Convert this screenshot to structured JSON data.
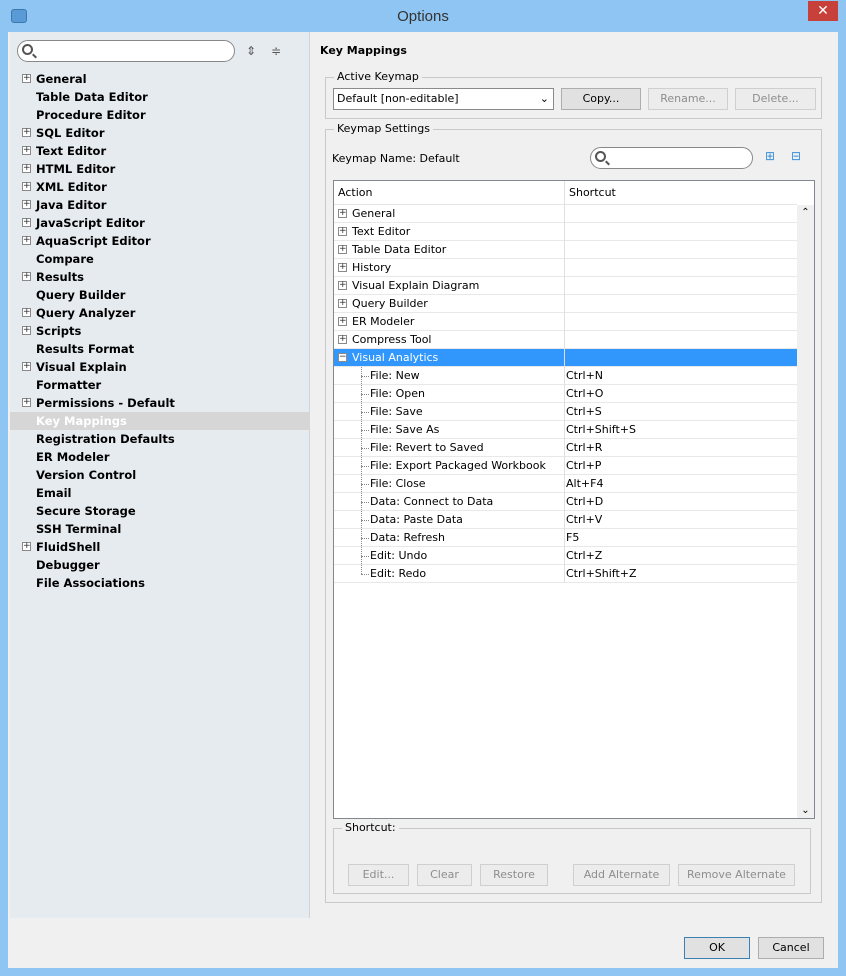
{
  "window": {
    "title": "Options",
    "close": "✕"
  },
  "nav": {
    "items": [
      {
        "label": "General",
        "expandable": true
      },
      {
        "label": "Table Data Editor",
        "expandable": false
      },
      {
        "label": "Procedure Editor",
        "expandable": false
      },
      {
        "label": "SQL Editor",
        "expandable": true
      },
      {
        "label": "Text Editor",
        "expandable": true
      },
      {
        "label": "HTML Editor",
        "expandable": true
      },
      {
        "label": "XML Editor",
        "expandable": true
      },
      {
        "label": "Java Editor",
        "expandable": true
      },
      {
        "label": "JavaScript Editor",
        "expandable": true
      },
      {
        "label": "AquaScript Editor",
        "expandable": true
      },
      {
        "label": "Compare",
        "expandable": false
      },
      {
        "label": "Results",
        "expandable": true
      },
      {
        "label": "Query Builder",
        "expandable": false
      },
      {
        "label": "Query Analyzer",
        "expandable": true
      },
      {
        "label": "Scripts",
        "expandable": true
      },
      {
        "label": "Results Format",
        "expandable": false
      },
      {
        "label": "Visual Explain",
        "expandable": true
      },
      {
        "label": "Formatter",
        "expandable": false
      },
      {
        "label": "Permissions - Default",
        "expandable": true
      },
      {
        "label": "Key Mappings",
        "expandable": false,
        "selected": true
      },
      {
        "label": "Registration Defaults",
        "expandable": false
      },
      {
        "label": "ER Modeler",
        "expandable": false
      },
      {
        "label": "Version Control",
        "expandable": false
      },
      {
        "label": "Email",
        "expandable": false
      },
      {
        "label": "Secure Storage",
        "expandable": false
      },
      {
        "label": "SSH Terminal",
        "expandable": false
      },
      {
        "label": "FluidShell",
        "expandable": true
      },
      {
        "label": "Debugger",
        "expandable": false
      },
      {
        "label": "File Associations",
        "expandable": false
      }
    ]
  },
  "main": {
    "heading": "Key Mappings",
    "active_keymap": {
      "label": "Active Keymap",
      "selected": "Default [non-editable]",
      "copy": "Copy...",
      "rename": "Rename...",
      "delete": "Delete..."
    },
    "settings": {
      "label": "Keymap Settings",
      "name_label": "Keymap Name: Default"
    },
    "table": {
      "headers": [
        "Action",
        "Shortcut"
      ],
      "groups": [
        "General",
        "Text Editor",
        "Table Data Editor",
        "History",
        "Visual Explain Diagram",
        "Query Builder",
        "ER Modeler",
        "Compress Tool"
      ],
      "expanded": "Visual Analytics",
      "children": [
        [
          "File: New",
          "Ctrl+N"
        ],
        [
          "File: Open",
          "Ctrl+O"
        ],
        [
          "File: Save",
          "Ctrl+S"
        ],
        [
          "File: Save As",
          "Ctrl+Shift+S"
        ],
        [
          "File: Revert to Saved",
          "Ctrl+R"
        ],
        [
          "File: Export Packaged Workbook",
          "Ctrl+P"
        ],
        [
          "File: Close",
          "Alt+F4"
        ],
        [
          "Data: Connect to Data",
          "Ctrl+D"
        ],
        [
          "Data: Paste Data",
          "Ctrl+V"
        ],
        [
          "Data: Refresh",
          "F5"
        ],
        [
          "Edit: Undo",
          "Ctrl+Z"
        ],
        [
          "Edit: Redo",
          "Ctrl+Shift+Z"
        ]
      ]
    },
    "shortcut": {
      "label": "Shortcut:",
      "edit": "Edit...",
      "clear": "Clear",
      "restore": "Restore",
      "add_alt": "Add Alternate",
      "remove_alt": "Remove Alternate"
    }
  },
  "footer": {
    "ok": "OK",
    "cancel": "Cancel"
  }
}
